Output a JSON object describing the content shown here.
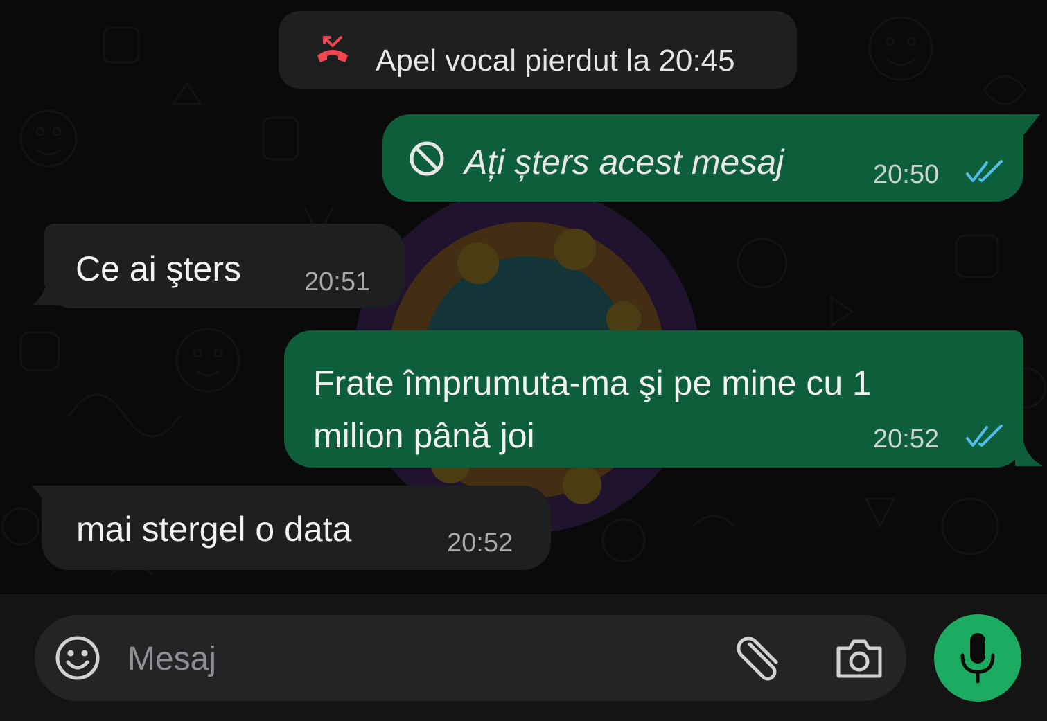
{
  "chat": {
    "missed_call": {
      "text": "Apel vocal pierdut la 20:45",
      "icon": "missed-call-icon"
    },
    "messages": [
      {
        "direction": "outgoing",
        "deleted": true,
        "text": "Ați șters acest mesaj",
        "time": "20:50",
        "status": "read",
        "icon": "blocked-icon"
      },
      {
        "direction": "incoming",
        "text": "Ce ai şters",
        "time": "20:51"
      },
      {
        "direction": "outgoing",
        "text": "Frate împrumuta-ma şi pe mine cu 1 milion până joi",
        "time": "20:52",
        "status": "read"
      },
      {
        "direction": "incoming",
        "text": "mai stergel o data",
        "time": "20:52"
      }
    ]
  },
  "composer": {
    "placeholder": "Mesaj",
    "emoji_icon": "emoji-icon",
    "attach_icon": "paperclip-icon",
    "camera_icon": "camera-icon",
    "mic_icon": "microphone-icon"
  },
  "colors": {
    "background": "#0a0a0a",
    "outgoing_bubble": "#0d5e3a",
    "incoming_bubble": "#1e1f21",
    "read_ticks": "#53bdeb",
    "missed_call_red": "#f0474f",
    "mic_button": "#1dab61"
  }
}
